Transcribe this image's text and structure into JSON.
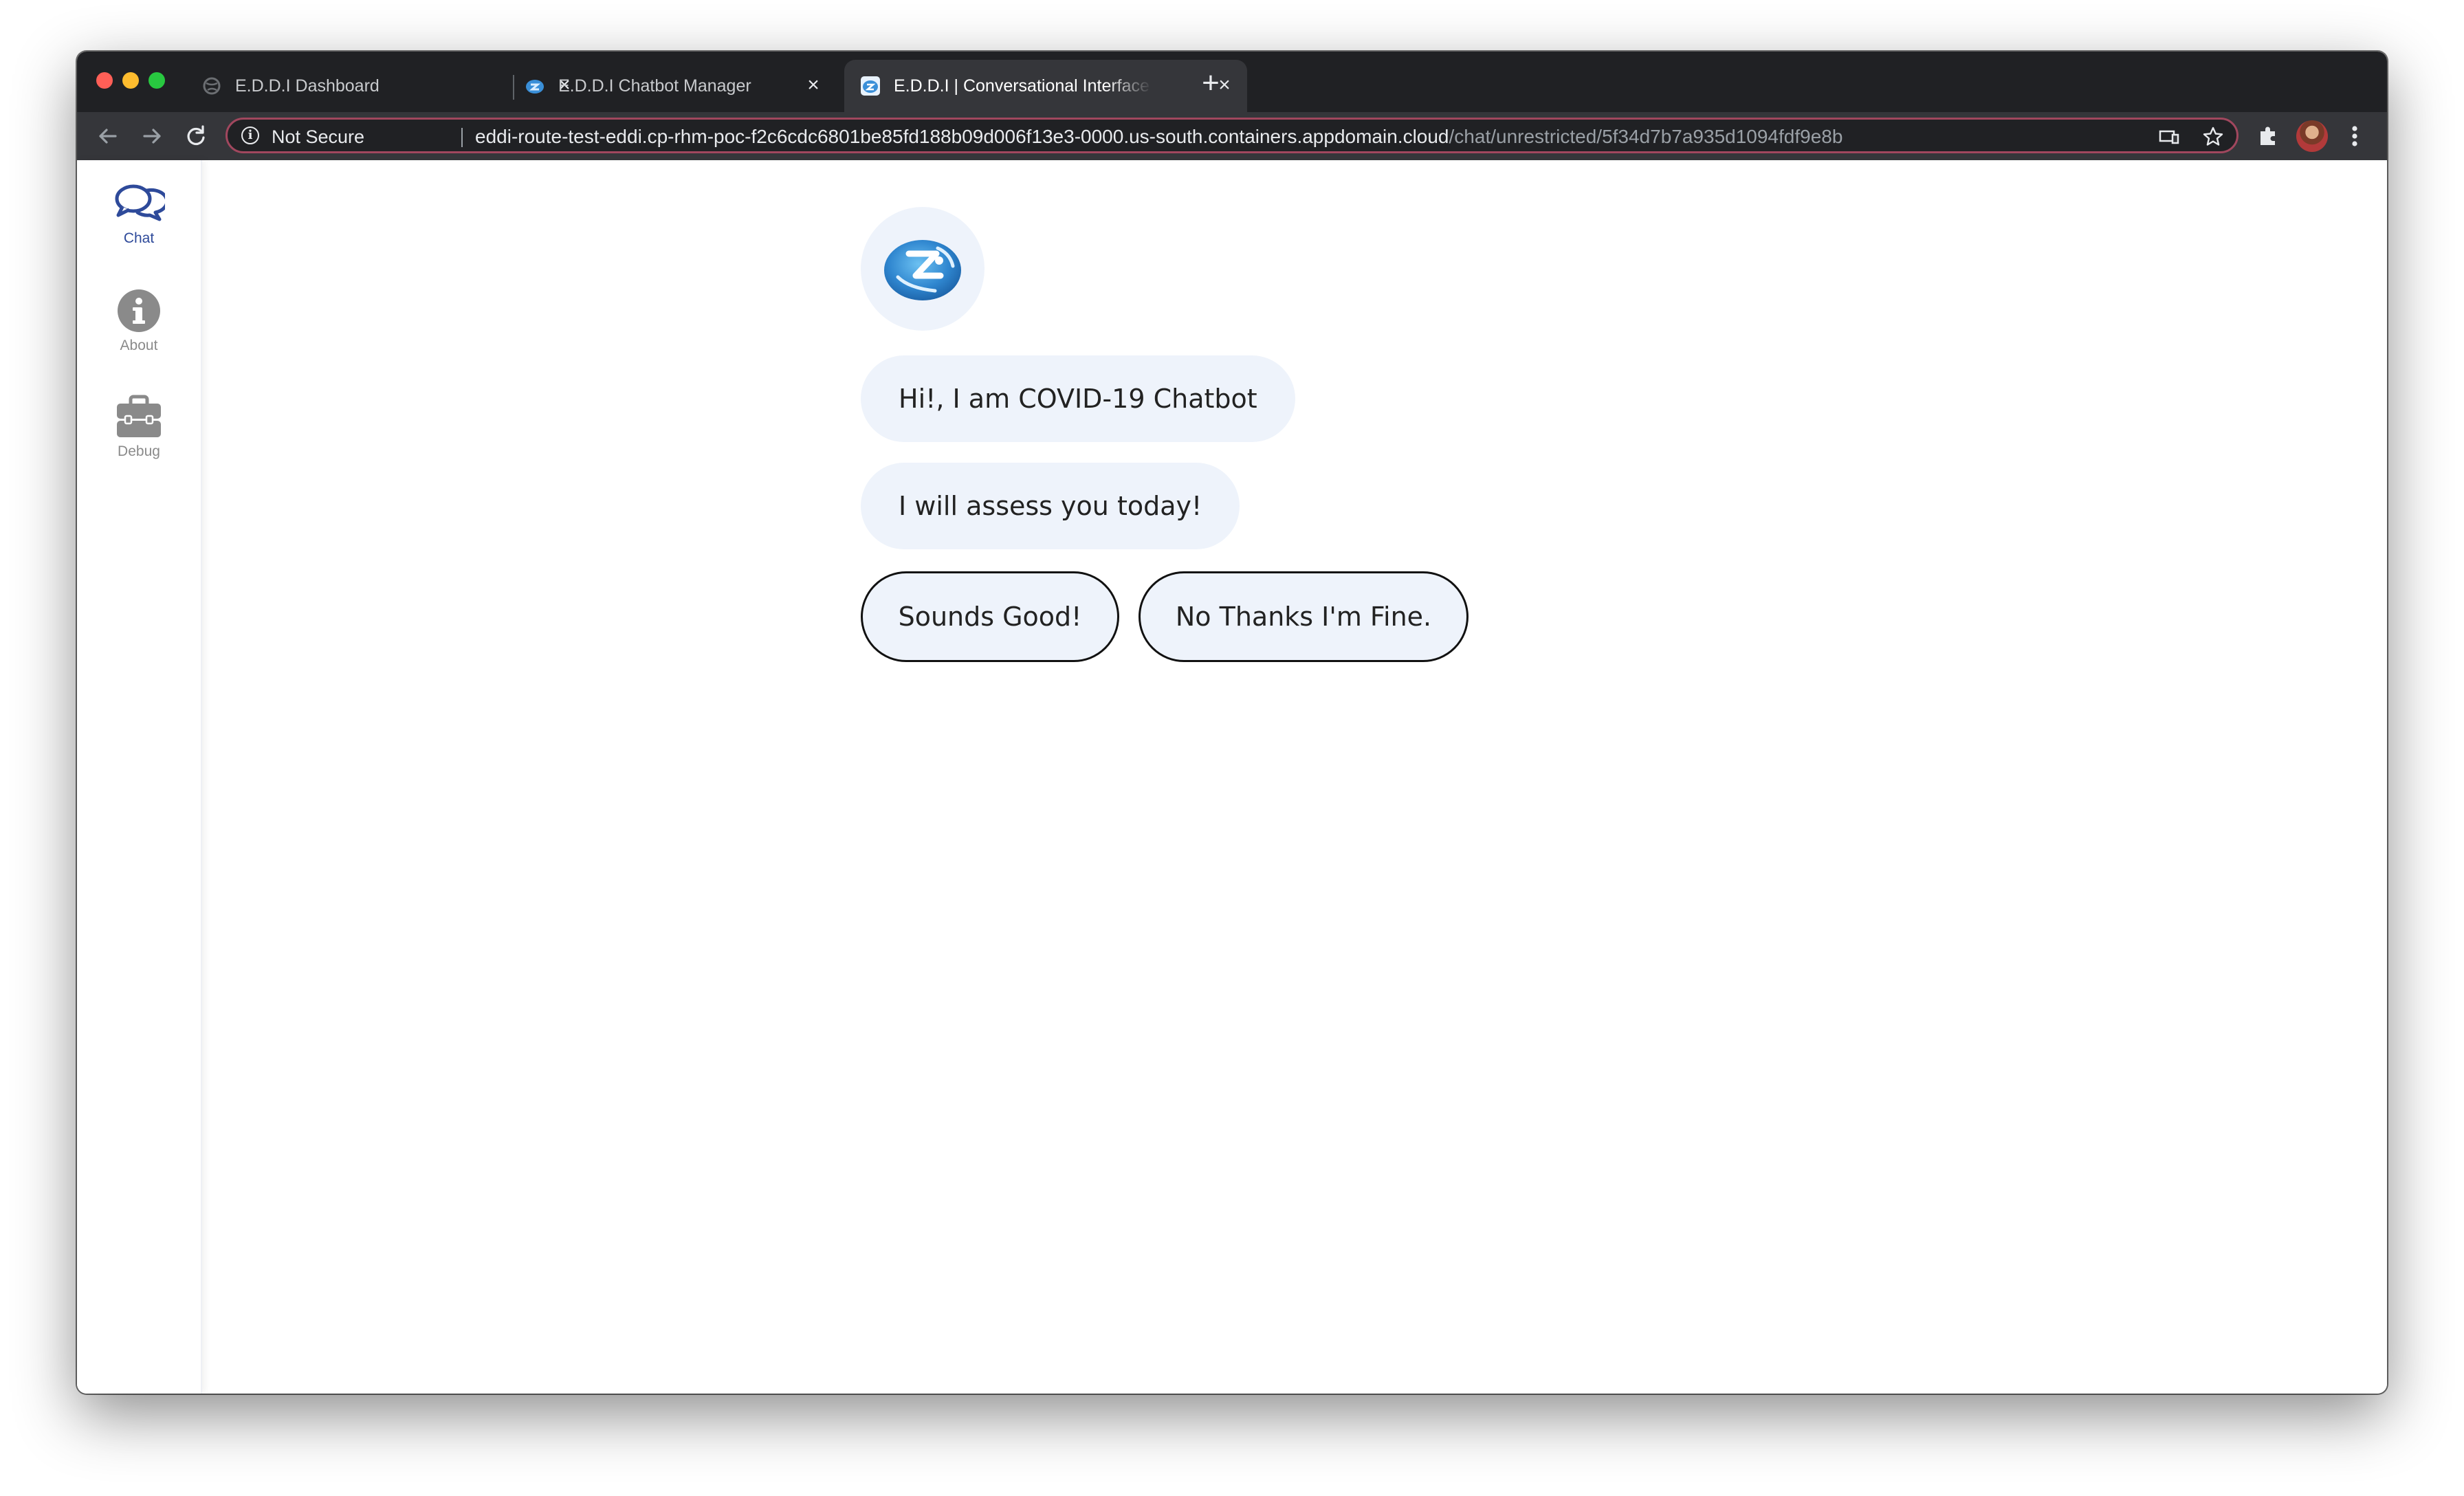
{
  "browser": {
    "tabs": [
      {
        "title": "E.D.D.I Dashboard",
        "active": false,
        "favicon": "globe-icon"
      },
      {
        "title": "E.D.D.I Chatbot Manager",
        "active": false,
        "favicon": "eddi-logo-icon"
      },
      {
        "title": "E.D.D.I | Conversational Interface",
        "active": true,
        "favicon": "eddi-logo-icon"
      }
    ],
    "close_glyph": "×",
    "new_tab_glyph": "+",
    "security_label": "Not Secure",
    "url_host": "eddi-route-test-eddi.cp-rhm-poc-f2c6cdc6801be85fd188b09d006f13e3-0000.us-south.containers.appdomain.cloud",
    "url_path": "/chat/unrestricted/5f34d7b7a935d1094fdf9e8b"
  },
  "sidebar": {
    "items": [
      {
        "label": "Chat",
        "icon": "chat-bubbles-icon",
        "active": true
      },
      {
        "label": "About",
        "icon": "info-circle-icon",
        "active": false
      },
      {
        "label": "Debug",
        "icon": "toolbox-icon",
        "active": false
      }
    ]
  },
  "chat": {
    "messages": [
      "Hi!, I am COVID-19 Chatbot",
      "I will assess you today!"
    ],
    "quick_replies": [
      "Sounds Good!",
      "No Thanks I'm Fine."
    ]
  },
  "colors": {
    "browser_frame": "#202124",
    "toolbar": "#35363a",
    "omnibox_border": "#a1475e",
    "bubble_bg": "#eef3fb",
    "accent_blue": "#2e4a9a",
    "sidebar_inactive": "#8a8a8a"
  }
}
